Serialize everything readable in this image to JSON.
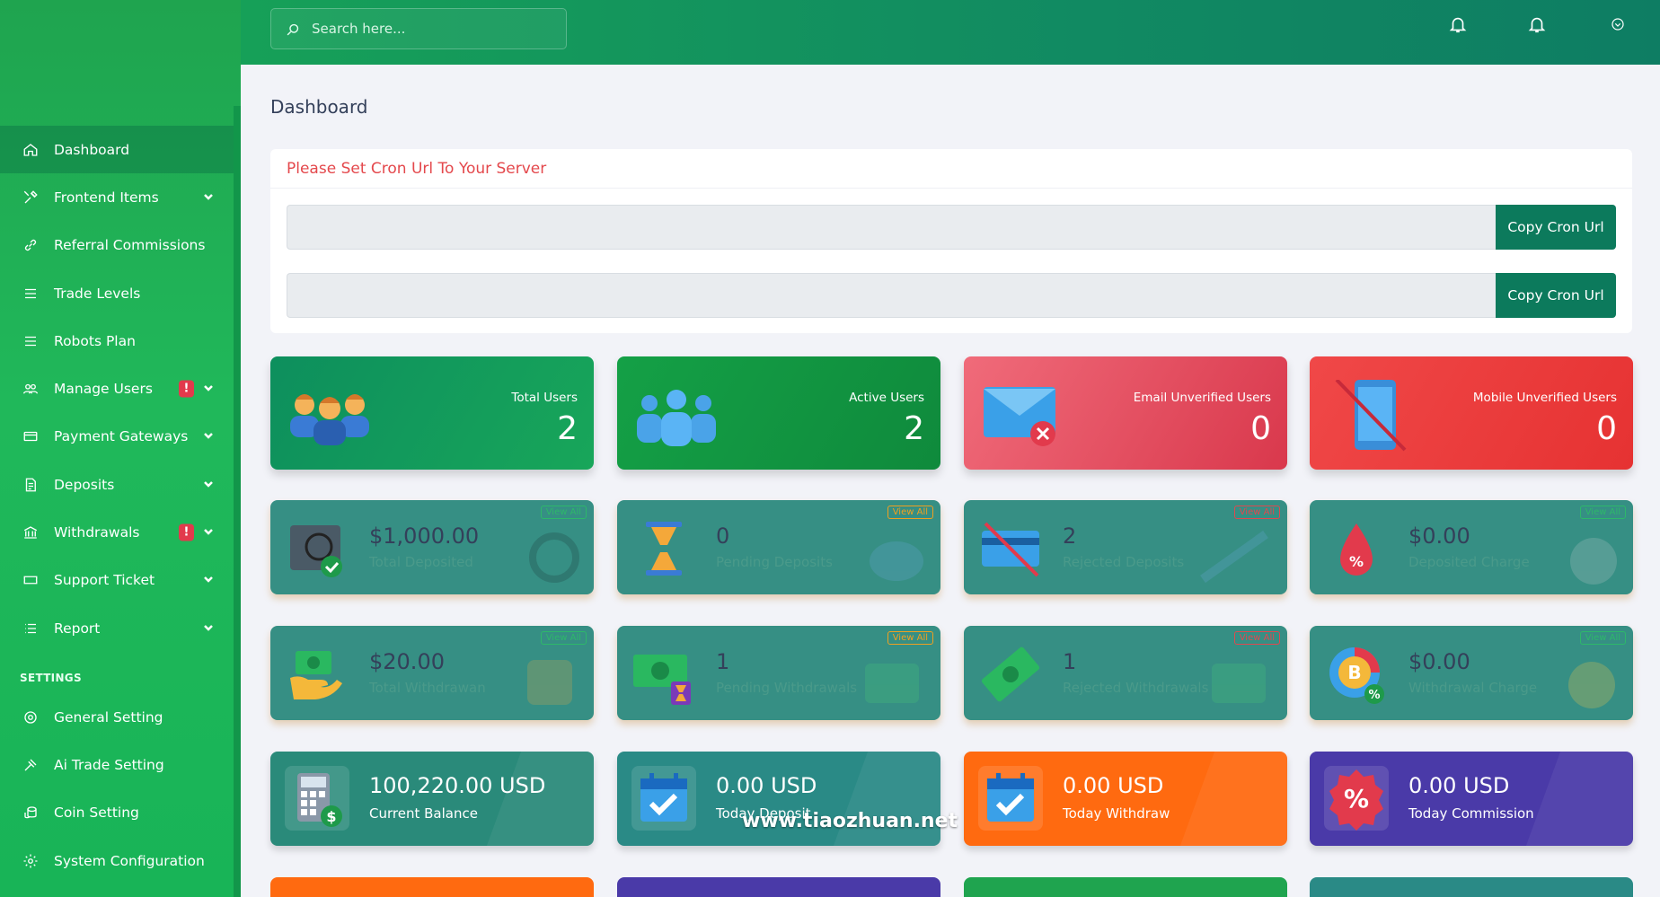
{
  "search": {
    "placeholder": "Search here..."
  },
  "sidebar": {
    "items": [
      {
        "label": "Dashboard",
        "icon": "home-icon",
        "active": true
      },
      {
        "label": "Frontend Items",
        "icon": "tools-icon",
        "chevron": true
      },
      {
        "label": "Referral Commissions",
        "icon": "link-icon"
      },
      {
        "label": "Trade Levels",
        "icon": "list-icon"
      },
      {
        "label": "Robots Plan",
        "icon": "list-icon"
      },
      {
        "label": "Manage Users",
        "icon": "users-icon",
        "chevron": true,
        "alert": "!"
      },
      {
        "label": "Payment Gateways",
        "icon": "credit-card-icon",
        "chevron": true
      },
      {
        "label": "Deposits",
        "icon": "document-icon",
        "chevron": true
      },
      {
        "label": "Withdrawals",
        "icon": "bank-icon",
        "chevron": true,
        "alert": "!"
      },
      {
        "label": "Support Ticket",
        "icon": "ticket-icon",
        "chevron": true
      },
      {
        "label": "Report",
        "icon": "report-list-icon",
        "chevron": true
      }
    ],
    "section_label": "SETTINGS",
    "settings": [
      {
        "label": "General Setting",
        "icon": "settings-circle-icon"
      },
      {
        "label": "Ai Trade Setting",
        "icon": "gavel-icon"
      },
      {
        "label": "Coin Setting",
        "icon": "coins-icon"
      },
      {
        "label": "System Configuration",
        "icon": "gear-icon"
      }
    ]
  },
  "main": {
    "title": "Dashboard",
    "cron": {
      "heading": "Please Set Cron Url To Your Server",
      "button_label": "Copy Cron Url"
    },
    "top_stats": [
      {
        "label": "Total Users",
        "value": "2",
        "color": "#0f8f5a"
      },
      {
        "label": "Active Users",
        "value": "2",
        "color": "#16a045"
      },
      {
        "label": "Email Unverified Users",
        "value": "0",
        "color": "#e04759"
      },
      {
        "label": "Mobile Unverified Users",
        "value": "0",
        "color": "#ec3a3a"
      }
    ],
    "deposit_stats": [
      {
        "value": "$1,000.00",
        "label": "Total Deposited",
        "view": "View All",
        "view_color": "#2db86a"
      },
      {
        "value": "0",
        "label": "Pending Deposits",
        "view": "View All",
        "view_color": "#f0a020"
      },
      {
        "value": "2",
        "label": "Rejected Deposits",
        "view": "View All",
        "view_color": "#e0484f"
      },
      {
        "value": "$0.00",
        "label": "Deposited Charge",
        "view": "View All",
        "view_color": "#2db86a"
      }
    ],
    "withdraw_stats": [
      {
        "value": "$20.00",
        "label": "Total Withdrawan",
        "view": "View All",
        "view_color": "#2db86a"
      },
      {
        "value": "1",
        "label": "Pending Withdrawals",
        "view": "View All",
        "view_color": "#f0a020"
      },
      {
        "value": "1",
        "label": "Rejected Withdrawals",
        "view": "View All",
        "view_color": "#e0484f"
      },
      {
        "value": "$0.00",
        "label": "Withdrawal Charge",
        "view": "View All",
        "view_color": "#2db86a"
      }
    ],
    "summary": [
      {
        "value": "100,220.00 USD",
        "label": "Current Balance",
        "color": "#2a8a7a"
      },
      {
        "value": "0.00 USD",
        "label": "Today Deposit",
        "color": "#2a8a86"
      },
      {
        "value": "0.00 USD",
        "label": "Today Withdraw",
        "color": "#ff6a10"
      },
      {
        "value": "0.00 USD",
        "label": "Today Commission",
        "color": "#4a3aa8"
      }
    ],
    "watermark": "www.tiaozhuan.net"
  }
}
